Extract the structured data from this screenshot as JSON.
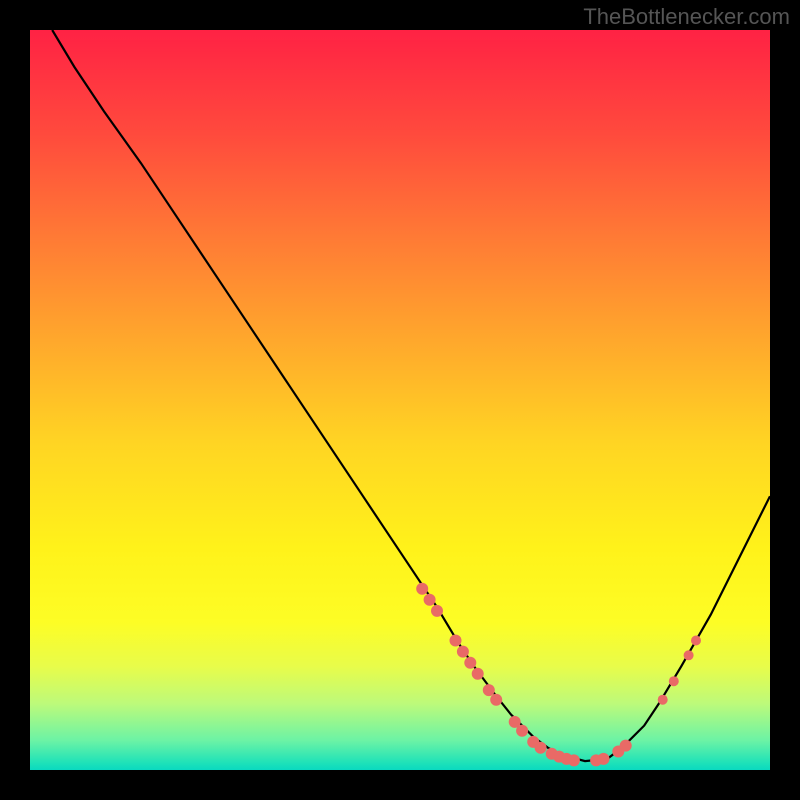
{
  "watermark": "TheBottlenecker.com",
  "chart_data": {
    "type": "line",
    "title": "",
    "xlabel": "",
    "ylabel": "",
    "xlim": [
      0,
      100
    ],
    "ylim": [
      0,
      100
    ],
    "curve": {
      "name": "bottleneck-curve",
      "x": [
        3,
        6,
        10,
        15,
        20,
        25,
        30,
        35,
        40,
        45,
        50,
        55,
        58,
        60,
        63,
        65,
        68,
        70,
        72,
        75,
        78,
        80,
        83,
        85,
        88,
        92,
        96,
        100
      ],
      "y": [
        100,
        95,
        89,
        82,
        74.5,
        67,
        59.5,
        52,
        44.5,
        37,
        29.5,
        22,
        17,
        14,
        10,
        7.5,
        4.5,
        3,
        2,
        1.2,
        1.5,
        3,
        6,
        9,
        14,
        21,
        29,
        37
      ]
    },
    "markers": [
      {
        "x": 53.0,
        "y": 24.5,
        "r": 6
      },
      {
        "x": 54.0,
        "y": 23.0,
        "r": 6
      },
      {
        "x": 55.0,
        "y": 21.5,
        "r": 6
      },
      {
        "x": 57.5,
        "y": 17.5,
        "r": 6
      },
      {
        "x": 58.5,
        "y": 16.0,
        "r": 6
      },
      {
        "x": 59.5,
        "y": 14.5,
        "r": 6
      },
      {
        "x": 60.5,
        "y": 13.0,
        "r": 6
      },
      {
        "x": 62.0,
        "y": 10.8,
        "r": 6
      },
      {
        "x": 63.0,
        "y": 9.5,
        "r": 6
      },
      {
        "x": 65.5,
        "y": 6.5,
        "r": 6
      },
      {
        "x": 66.5,
        "y": 5.3,
        "r": 6
      },
      {
        "x": 68.0,
        "y": 3.8,
        "r": 6
      },
      {
        "x": 69.0,
        "y": 3.0,
        "r": 6
      },
      {
        "x": 70.5,
        "y": 2.2,
        "r": 6
      },
      {
        "x": 71.5,
        "y": 1.8,
        "r": 6
      },
      {
        "x": 72.5,
        "y": 1.5,
        "r": 6
      },
      {
        "x": 73.5,
        "y": 1.3,
        "r": 6
      },
      {
        "x": 76.5,
        "y": 1.3,
        "r": 6
      },
      {
        "x": 77.5,
        "y": 1.5,
        "r": 6
      },
      {
        "x": 79.5,
        "y": 2.5,
        "r": 6
      },
      {
        "x": 80.5,
        "y": 3.3,
        "r": 6
      },
      {
        "x": 85.5,
        "y": 9.5,
        "r": 5
      },
      {
        "x": 87.0,
        "y": 12.0,
        "r": 5
      },
      {
        "x": 89.0,
        "y": 15.5,
        "r": 5
      },
      {
        "x": 90.0,
        "y": 17.5,
        "r": 5
      }
    ],
    "colors": {
      "curve_stroke": "#000000",
      "marker_fill": "#e96a66"
    }
  }
}
